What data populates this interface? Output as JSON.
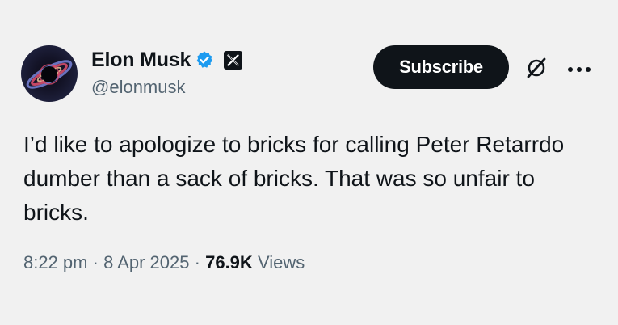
{
  "author": {
    "name": "Elon Musk",
    "handle": "@elonmusk",
    "verified_color": "#1d9bf0"
  },
  "actions": {
    "subscribe_label": "Subscribe",
    "icons": [
      "grok-icon",
      "more-icon"
    ]
  },
  "post": {
    "text": "I’d like to apologize to bricks for calling Peter Retarrdo dumber than a sack of bricks. That was so unfair to bricks."
  },
  "meta": {
    "time": "8:22 pm",
    "separator": "·",
    "date": "8 Apr 2025",
    "views_count": "76.9K",
    "views_label": "Views"
  },
  "colors": {
    "background": "#f1f1f1",
    "text": "#0f1419",
    "secondary_text": "#536471",
    "button_bg": "#0f1419"
  }
}
